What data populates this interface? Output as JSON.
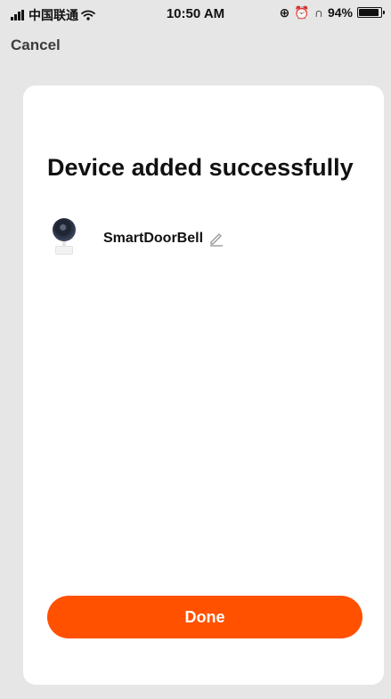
{
  "status_bar": {
    "carrier": "中国联通",
    "time": "10:50 AM",
    "battery_text": "94%",
    "battery_level": 0.94,
    "icons": [
      "signal-icon",
      "wifi-icon",
      "lock-rotation-icon",
      "alarm-icon",
      "headphones-icon",
      "battery-icon"
    ]
  },
  "nav": {
    "cancel_label": "Cancel"
  },
  "card": {
    "title": "Device added successfully",
    "device": {
      "name": "SmartDoorBell",
      "icon": "camera-icon",
      "edit_icon": "pencil-icon"
    },
    "done_label": "Done"
  },
  "colors": {
    "accent": "#ff5100",
    "background": "#e6e6e6",
    "card": "#ffffff"
  }
}
